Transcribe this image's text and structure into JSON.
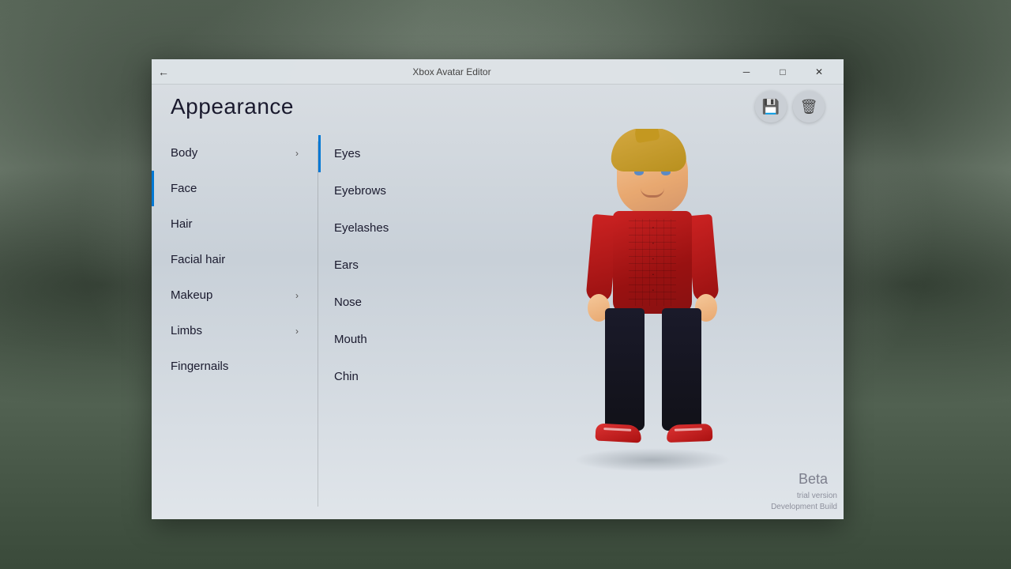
{
  "window": {
    "title": "Xbox Avatar Editor",
    "back_label": "←",
    "minimize_label": "─",
    "restore_label": "□",
    "close_label": "✕"
  },
  "header": {
    "title": "Appearance",
    "save_label": "💾",
    "delete_label": "🗑"
  },
  "left_menu": {
    "items": [
      {
        "id": "body",
        "label": "Body",
        "has_chevron": true,
        "active": false
      },
      {
        "id": "face",
        "label": "Face",
        "has_chevron": false,
        "active": true
      },
      {
        "id": "hair",
        "label": "Hair",
        "has_chevron": false,
        "active": false
      },
      {
        "id": "facial-hair",
        "label": "Facial hair",
        "has_chevron": false,
        "active": false
      },
      {
        "id": "makeup",
        "label": "Makeup",
        "has_chevron": true,
        "active": false
      },
      {
        "id": "limbs",
        "label": "Limbs",
        "has_chevron": true,
        "active": false
      },
      {
        "id": "fingernails",
        "label": "Fingernails",
        "has_chevron": false,
        "active": false
      }
    ]
  },
  "sub_menu": {
    "items": [
      {
        "id": "eyes",
        "label": "Eyes",
        "active": true
      },
      {
        "id": "eyebrows",
        "label": "Eyebrows",
        "active": false
      },
      {
        "id": "eyelashes",
        "label": "Eyelashes",
        "active": false
      },
      {
        "id": "ears",
        "label": "Ears",
        "active": false
      },
      {
        "id": "nose",
        "label": "Nose",
        "active": false
      },
      {
        "id": "mouth",
        "label": "Mouth",
        "active": false
      },
      {
        "id": "chin",
        "label": "Chin",
        "active": false
      }
    ]
  },
  "footer": {
    "beta_label": "Beta",
    "trial_line1": "trial version",
    "trial_line2": "Development Build"
  },
  "colors": {
    "accent": "#0078d4",
    "bg": "#d8dde2"
  }
}
